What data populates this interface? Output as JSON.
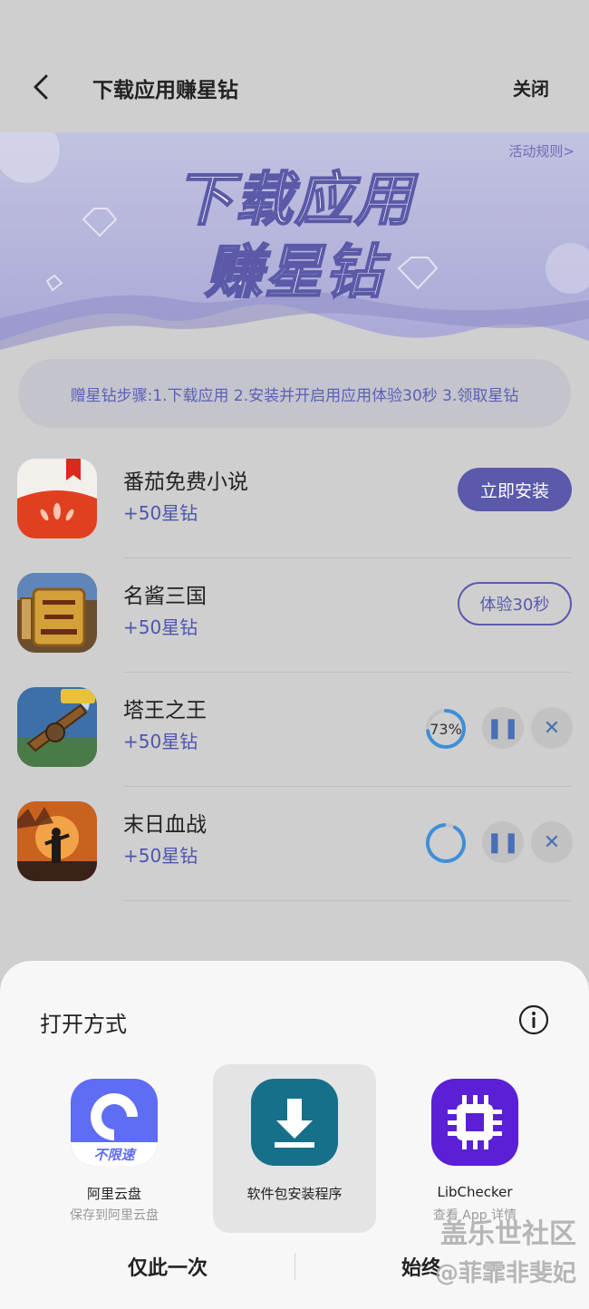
{
  "header": {
    "title": "下载应用赚星钻",
    "close_label": "关闭"
  },
  "banner": {
    "rules_label": "活动规则>",
    "title_line1": "下载应用",
    "title_line2": "赚星钻"
  },
  "steps": "赠星钻步骤:1.下载应用 2.安装并开启用应用体验30秒 3.领取星钻",
  "apps": [
    {
      "name": "番茄免费小说",
      "reward": "+50星钻",
      "action": "立即安装"
    },
    {
      "name": "名酱三国",
      "reward": "+50星钻",
      "action": "体验30秒"
    },
    {
      "name": "塔王之王",
      "reward": "+50星钻",
      "progress_text": "73%",
      "progress": 0.73
    },
    {
      "name": "末日血战",
      "reward": "+50星钻",
      "progress": 0.9
    }
  ],
  "sheet": {
    "title": "打开方式",
    "choices": [
      {
        "label": "阿里云盘",
        "sub": "保存到阿里云盘",
        "badge": "不限速"
      },
      {
        "label": "软件包安装程序",
        "sub": ""
      },
      {
        "label": "LibChecker",
        "sub": "查看 App 详情"
      }
    ],
    "once_label": "仅此一次",
    "always_label": "始终"
  },
  "watermark": {
    "line1": "盖乐世社区",
    "line2": "@菲霏非斐妃"
  },
  "colors": {
    "accent": "#5a59ac",
    "reward": "#4e55b0",
    "progress": "#3f8fd8"
  }
}
